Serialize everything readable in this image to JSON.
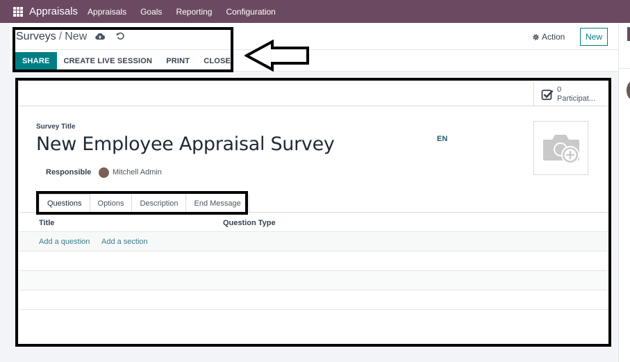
{
  "navbar": {
    "app_name": "Appraisals",
    "menus": [
      "Appraisals",
      "Goals",
      "Reporting",
      "Configuration"
    ]
  },
  "control_panel": {
    "breadcrumb": {
      "parent": "Surveys",
      "separator": "/",
      "current": "New"
    },
    "save_icon": "cloud-upload-icon",
    "discard_icon": "undo-icon",
    "action_label": "Action",
    "new_label": "New",
    "header_buttons": [
      "SHARE",
      "CREATE LIVE SESSION",
      "PRINT",
      "CLOSE"
    ]
  },
  "form": {
    "stat_button": {
      "count": "0",
      "label": "Participat..."
    },
    "title_label": "Survey Title",
    "title_value": "New Employee Appraisal Survey",
    "language": "EN",
    "responsible_label": "Responsible",
    "responsible_value": "Mitchell Admin",
    "tabs": [
      "Questions",
      "Options",
      "Description",
      "End Message"
    ],
    "active_tab": "Questions",
    "list": {
      "columns": [
        "Title",
        "Question Type"
      ],
      "add_question": "Add a question",
      "add_section": "Add a section"
    }
  },
  "colors": {
    "navbar": "#6b4a61",
    "primary": "#017e84",
    "link": "#3c7d8a"
  }
}
